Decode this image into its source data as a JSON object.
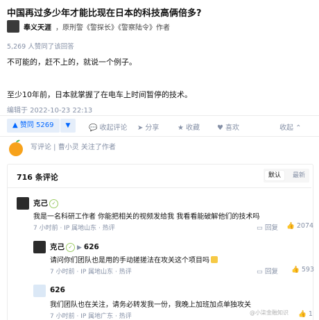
{
  "question": {
    "title": "中国再过多少年才能比现在日本的科技高俩倍多?"
  },
  "author": {
    "name": "奉义天涯",
    "bio": "，原刑警《警探长》《警察陆令》作者"
  },
  "answer": {
    "upvote_note": "5,269 人赞同了该回答",
    "paragraphs": [
      "不可能的，赶不上的，就说一个例子。",
      "至少10年前，日本就掌握了在电车上时间暂停的技术。"
    ],
    "edited": "编辑于 2022-10-23 22:13"
  },
  "actions": {
    "upvote_label": "▲ 赞同 5269",
    "downvote_label": "▼",
    "collapse_comments": "收起评论",
    "share": "分享",
    "favorite": "收藏",
    "like": "喜欢",
    "collapse": "收起"
  },
  "comment_box": {
    "placeholder": "写评论 | 曹小灵 关注了作者"
  },
  "comments": {
    "count_label": "716 条评论",
    "sort": {
      "default": "默认",
      "latest": "最新"
    },
    "items": [
      {
        "name": "克己",
        "text": "我是一名科研工作者 你能把相关的视频发给我 我看看能破解他们的技术吗",
        "meta": "7 小时前 · IP 属地山东 · ",
        "hot": "热评",
        "reply": "回复",
        "likes": "2074"
      },
      {
        "name": "克己",
        "reply_to": "626",
        "text": "请问你们团队也是用的手动搓搓法在攻关这个项目吗",
        "meta": "7 小时前 · IP 属地山东 · ",
        "hot": "热评",
        "reply": "回复",
        "likes": "593"
      },
      {
        "name": "626",
        "text": "我们团队也在关注，请务必转发我一份，我晚上加班加点单独攻关",
        "meta": "7 小时前 · IP 属地广东 · ",
        "hot": "热评",
        "likes": "1"
      }
    ]
  },
  "watermark": "@小柒金融知识",
  "colors": {
    "accent": "#0066ff",
    "accent_bg": "#e5eefa",
    "muted": "#8590a6"
  }
}
